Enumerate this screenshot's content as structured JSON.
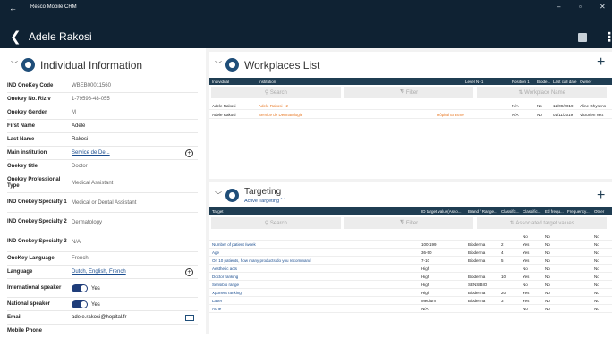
{
  "window": {
    "app_name": "Resco Mobile CRM",
    "back": "←",
    "minimize": "–",
    "maximize": "▫",
    "close": "✕"
  },
  "header": {
    "back_symbol": "❮",
    "title": "Adele Rakosi",
    "more_symbol": "⋮"
  },
  "individual": {
    "title": "Individual Information",
    "rows": [
      {
        "label": "IND OneKey Code",
        "value": "WBEB00011560"
      },
      {
        "label": "Onekey No. Riziv",
        "value": "1-79596-48-055"
      },
      {
        "label": "Onekey Gender",
        "value": "M"
      },
      {
        "label": "First Name",
        "value": "Adele"
      },
      {
        "label": "Last Name",
        "value": "Rakosi"
      },
      {
        "label": "Main institution",
        "value": "Service de De..."
      },
      {
        "label": "Onekey title",
        "value": "Doctor"
      },
      {
        "label": "Onekey Professional Type",
        "value": "Medical Assistant"
      },
      {
        "label": "IND Onekey Specialty 1",
        "value": "Medical or Dental Assistant"
      },
      {
        "label": "IND Onekey Specialty 2",
        "value": "Dermatology"
      },
      {
        "label": "IND Onekey Specialty 3",
        "value": "N/A"
      },
      {
        "label": "OneKey Language",
        "value": "French"
      },
      {
        "label": "Language",
        "value": "Dutch, English, French"
      },
      {
        "label": "International speaker",
        "value": "Yes"
      },
      {
        "label": "National speaker",
        "value": "Yes"
      },
      {
        "label": "Email",
        "value": "adele.rakosi@hopital.fr"
      },
      {
        "label": "Mobile Phone",
        "value": ""
      }
    ]
  },
  "workplaces": {
    "title": "Workplaces List",
    "columns": [
      "Individual",
      "Institution",
      "Level N+1",
      "Position 1",
      "Biode...",
      "Last call date",
      "Owner"
    ],
    "filters": {
      "search": "Search",
      "filter": "Filter",
      "sort": "Workplace Name"
    },
    "rows": [
      [
        "Adele Rakosi",
        "Adele Rakosi - 2",
        "",
        "N/A",
        "No",
        "12/09/2019",
        "Aline Ghysens"
      ],
      [
        "Adele Rakosi",
        "Service de Dermatologie",
        "Hôpital Erasme",
        "N/A",
        "No",
        "01/11/2019",
        "Victorien Nez"
      ]
    ]
  },
  "targeting": {
    "title": "Targeting",
    "subtitle": "Active Targeting",
    "columns": [
      "Target",
      "ID target value(Asso...",
      "Brand / Range...",
      "Classific...",
      "Classific...",
      "Ed frequ...",
      "Frequency...",
      "Other"
    ],
    "filters": {
      "search": "Search",
      "filter": "Filter",
      "sort": "Associated target values"
    },
    "rows": [
      [
        "",
        "",
        "",
        "",
        "No",
        "No",
        "",
        "No"
      ],
      [
        "Number of patient /week",
        "100-199",
        "Bioderma",
        "2",
        "Yes",
        "No",
        "",
        "No"
      ],
      [
        "Age",
        "36-50",
        "Bioderma",
        "4",
        "Yes",
        "No",
        "",
        "No"
      ],
      [
        "On 10 patients, how many products do you recommand",
        "7-10",
        "Bioderma",
        "5",
        "Yes",
        "No",
        "",
        "No"
      ],
      [
        "Aesthetic acts",
        "High",
        "",
        "",
        "No",
        "No",
        "",
        "No"
      ],
      [
        "Doctor ranking",
        "High",
        "Bioderma",
        "10",
        "Yes",
        "No",
        "",
        "No"
      ],
      [
        "Sensibio range",
        "High",
        "SENSIBIO",
        "",
        "No",
        "No",
        "",
        "No"
      ],
      [
        "Xponent ranking",
        "High",
        "Bioderma",
        "20",
        "Yes",
        "No",
        "",
        "No"
      ],
      [
        "Laser",
        "Medium",
        "Bioderma",
        "3",
        "Yes",
        "No",
        "",
        "No"
      ],
      [
        "Acne",
        "N/A",
        "",
        "",
        "No",
        "No",
        "",
        "No"
      ]
    ]
  }
}
